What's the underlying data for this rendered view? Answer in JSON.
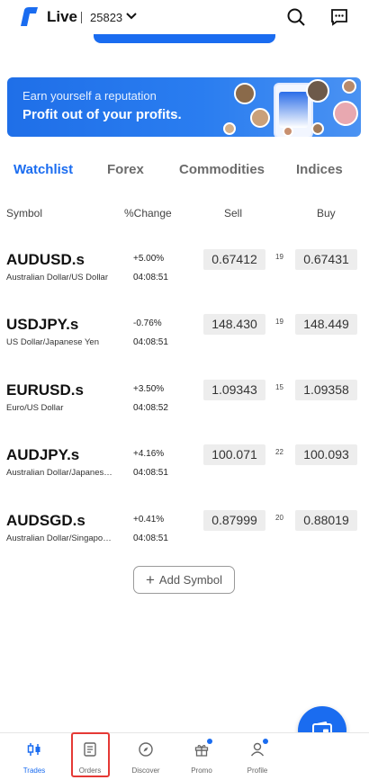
{
  "header": {
    "mode_label": "Live",
    "account_number": "25823"
  },
  "banner": {
    "line1": "Earn yourself a reputation",
    "line2": "Profit out of your profits."
  },
  "tabs": [
    {
      "label": "Watchlist",
      "active": true
    },
    {
      "label": "Forex",
      "active": false
    },
    {
      "label": "Commodities",
      "active": false
    },
    {
      "label": "Indices",
      "active": false
    }
  ],
  "columns": {
    "symbol": "Symbol",
    "change": "%Change",
    "sell": "Sell",
    "buy": "Buy"
  },
  "rows": [
    {
      "symbol": "AUDUSD.s",
      "description": "Australian Dollar/US Dollar",
      "change": "+5.00%",
      "time": "04:08:51",
      "sell": "0.67412",
      "spread": "19",
      "buy": "0.67431"
    },
    {
      "symbol": "USDJPY.s",
      "description": "US Dollar/Japanese Yen",
      "change": "-0.76%",
      "time": "04:08:51",
      "sell": "148.430",
      "spread": "19",
      "buy": "148.449"
    },
    {
      "symbol": "EURUSD.s",
      "description": "Euro/US Dollar",
      "change": "+3.50%",
      "time": "04:08:52",
      "sell": "1.09343",
      "spread": "15",
      "buy": "1.09358"
    },
    {
      "symbol": "AUDJPY.s",
      "description": "Australian Dollar/Japanes…",
      "change": "+4.16%",
      "time": "04:08:51",
      "sell": "100.071",
      "spread": "22",
      "buy": "100.093"
    },
    {
      "symbol": "AUDSGD.s",
      "description": "Australian Dollar/Singapo…",
      "change": "+0.41%",
      "time": "04:08:51",
      "sell": "0.87999",
      "spread": "20",
      "buy": "0.88019"
    }
  ],
  "add_symbol_label": "Add Symbol",
  "nav": [
    {
      "label": "Trades",
      "icon": "candlestick-icon",
      "active": true
    },
    {
      "label": "Orders",
      "icon": "orders-icon",
      "active": false
    },
    {
      "label": "Discover",
      "icon": "compass-icon",
      "active": false
    },
    {
      "label": "Promo",
      "icon": "gift-icon",
      "active": false
    },
    {
      "label": "Profile",
      "icon": "person-icon",
      "active": false
    }
  ],
  "colors": {
    "accent": "#1a6cf0",
    "highlight": "#e53935"
  }
}
